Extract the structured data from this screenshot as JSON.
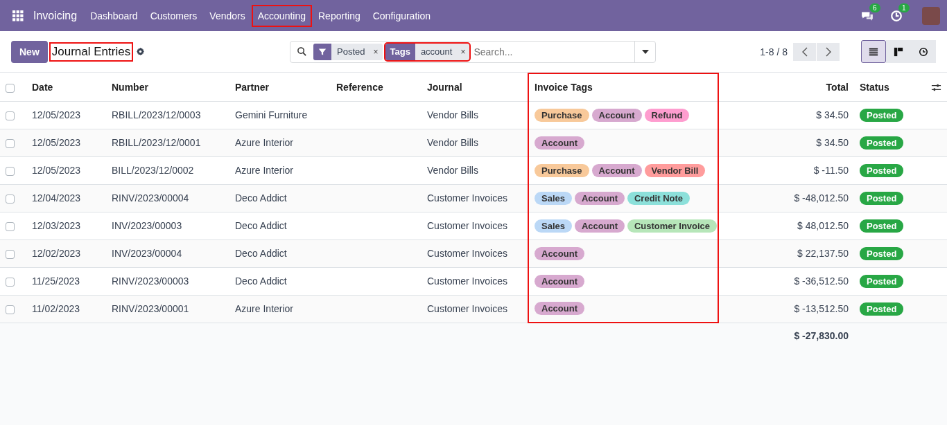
{
  "navbar": {
    "app": "Invoicing",
    "menu": [
      {
        "label": "Dashboard",
        "highlighted": false
      },
      {
        "label": "Customers",
        "highlighted": false
      },
      {
        "label": "Vendors",
        "highlighted": false
      },
      {
        "label": "Accounting",
        "highlighted": true
      },
      {
        "label": "Reporting",
        "highlighted": false
      },
      {
        "label": "Configuration",
        "highlighted": false
      }
    ],
    "messages_count": "6",
    "activities_count": "1"
  },
  "control_panel": {
    "new_button": "New",
    "title": "Journal Entries",
    "title_highlighted": true,
    "facets": [
      {
        "kind": "filter",
        "label": "Posted",
        "remove": "×",
        "highlighted": false
      },
      {
        "kind": "field",
        "field": "Tags",
        "label": "account",
        "remove": "×",
        "highlighted": true
      }
    ],
    "search": {
      "placeholder": "Search..."
    },
    "pager": "1-8 / 8",
    "views": [
      {
        "kind": "list",
        "selected": true
      },
      {
        "kind": "kanban",
        "selected": false
      },
      {
        "kind": "activity",
        "selected": false
      }
    ]
  },
  "table": {
    "select_all_checked": false,
    "columns": [
      {
        "label": "Date",
        "highlighted": false
      },
      {
        "label": "Number",
        "highlighted": false
      },
      {
        "label": "Partner",
        "highlighted": false
      },
      {
        "label": "Reference",
        "highlighted": false
      },
      {
        "label": "Journal",
        "highlighted": false
      },
      {
        "label": "Invoice Tags",
        "highlighted": true
      },
      {
        "label": "Total",
        "highlighted": false
      },
      {
        "label": "Status",
        "highlighted": false
      }
    ],
    "rows": [
      {
        "checked": false,
        "date": "12/05/2023",
        "number": "RBILL/2023/12/0003",
        "partner": "Gemini Furniture",
        "journal": "Vendor Bills",
        "tags": [
          {
            "label": "Purchase",
            "color": "#f8c99a"
          },
          {
            "label": "Account",
            "color": "#d7a9cf"
          },
          {
            "label": "Refund",
            "color": "#fe9dcf"
          }
        ],
        "total": "$ 34.50",
        "status": "Posted"
      },
      {
        "checked": false,
        "date": "12/05/2023",
        "number": "RBILL/2023/12/0001",
        "partner": "Azure Interior",
        "journal": "Vendor Bills",
        "tags": [
          {
            "label": "Account",
            "color": "#d7a9cf"
          }
        ],
        "total": "$ 34.50",
        "status": "Posted"
      },
      {
        "checked": false,
        "date": "12/05/2023",
        "number": "BILL/2023/12/0002",
        "partner": "Azure Interior",
        "journal": "Vendor Bills",
        "tags": [
          {
            "label": "Purchase",
            "color": "#f8c99a"
          },
          {
            "label": "Account",
            "color": "#d7a9cf"
          },
          {
            "label": "Vendor Bill",
            "color": "#ff9c9c"
          }
        ],
        "total": "$ -11.50",
        "status": "Posted"
      },
      {
        "checked": false,
        "date": "12/04/2023",
        "number": "RINV/2023/00004",
        "partner": "Deco Addict",
        "journal": "Customer Invoices",
        "tags": [
          {
            "label": "Sales",
            "color": "#bbd8f6"
          },
          {
            "label": "Account",
            "color": "#d7a9cf"
          },
          {
            "label": "Credit Note",
            "color": "#8ce0da"
          }
        ],
        "total": "$ -48,012.50",
        "status": "Posted"
      },
      {
        "checked": false,
        "date": "12/03/2023",
        "number": "INV/2023/00003",
        "partner": "Deco Addict",
        "journal": "Customer Invoices",
        "tags": [
          {
            "label": "Sales",
            "color": "#bbd8f6"
          },
          {
            "label": "Account",
            "color": "#d7a9cf"
          },
          {
            "label": "Customer Invoice",
            "color": "#b6e6b9"
          }
        ],
        "total": "$ 48,012.50",
        "status": "Posted"
      },
      {
        "checked": false,
        "date": "12/02/2023",
        "number": "INV/2023/00004",
        "partner": "Deco Addict",
        "journal": "Customer Invoices",
        "tags": [
          {
            "label": "Account",
            "color": "#d7a9cf"
          }
        ],
        "total": "$ 22,137.50",
        "status": "Posted"
      },
      {
        "checked": false,
        "date": "11/25/2023",
        "number": "RINV/2023/00003",
        "partner": "Deco Addict",
        "journal": "Customer Invoices",
        "tags": [
          {
            "label": "Account",
            "color": "#d7a9cf"
          }
        ],
        "total": "$ -36,512.50",
        "status": "Posted"
      },
      {
        "checked": false,
        "date": "11/02/2023",
        "number": "RINV/2023/00001",
        "partner": "Azure Interior",
        "journal": "Customer Invoices",
        "tags": [
          {
            "label": "Account",
            "color": "#d7a9cf"
          }
        ],
        "total": "$ -13,512.50",
        "status": "Posted"
      }
    ],
    "grand_total": "$ -27,830.00"
  }
}
